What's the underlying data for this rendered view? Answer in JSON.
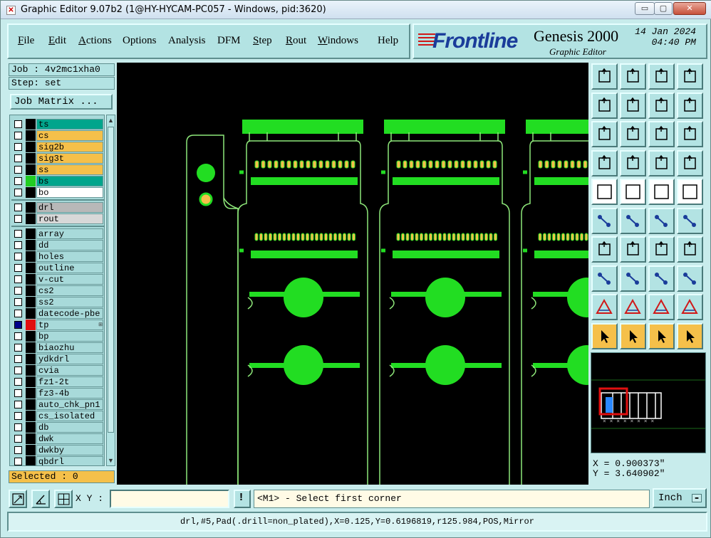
{
  "window": {
    "title": "Graphic Editor 9.07b2 (1@HY-HYCAM-PC057 - Windows, pid:3620)",
    "controls": {
      "minimize": "▭",
      "maximize": "▢",
      "close": "✕"
    }
  },
  "menu": [
    {
      "label": "File",
      "key": "file"
    },
    {
      "label": "Edit",
      "key": "edit"
    },
    {
      "label": "Actions",
      "key": "actions"
    },
    {
      "label": "Options",
      "key": "options"
    },
    {
      "label": "Analysis",
      "key": "analysis"
    },
    {
      "label": "DFM",
      "key": "dfm"
    },
    {
      "label": "Step",
      "key": "step"
    },
    {
      "label": "Rout",
      "key": "rout"
    },
    {
      "label": "Windows",
      "key": "windows"
    },
    {
      "label": "Help",
      "key": "help"
    }
  ],
  "brand": {
    "logo": "Frontline",
    "product": "Genesis 2000",
    "subtitle": "Graphic Editor",
    "date": "14 Jan 2024",
    "time": "04:40 PM"
  },
  "job": {
    "job_line": "Job : 4v2mc1xha0",
    "step_line": "Step: set",
    "matrix_button": "Job Matrix ..."
  },
  "layers": [
    {
      "name": "ts",
      "bg": "#00a58c",
      "swatch": "#000000",
      "checked": false
    },
    {
      "name": "cs",
      "bg": "#f5c04a",
      "swatch": "#000000",
      "checked": false
    },
    {
      "name": "sig2b",
      "bg": "#f5c04a",
      "swatch": "#000000",
      "checked": false
    },
    {
      "name": "sig3t",
      "bg": "#f5c04a",
      "swatch": "#000000",
      "checked": false
    },
    {
      "name": "ss",
      "bg": "#f5c04a",
      "swatch": "#000000",
      "checked": false
    },
    {
      "name": "bs",
      "bg": "#00a58c",
      "swatch": "#22cc22",
      "checked": false
    },
    {
      "name": "bo",
      "bg": "#ffffff",
      "swatch": "#000000",
      "checked": false
    },
    {
      "name": "drl",
      "bg": "#b8b8b8",
      "swatch": "#000000",
      "checked": false
    },
    {
      "name": "rout",
      "bg": "#d8d8d8",
      "swatch": "#000000",
      "checked": false
    },
    {
      "name": "array",
      "bg": "#a8dada",
      "swatch": "#000000",
      "checked": false
    },
    {
      "name": "dd",
      "bg": "#a8dada",
      "swatch": "#000000",
      "checked": false
    },
    {
      "name": "holes",
      "bg": "#a8dada",
      "swatch": "#000000",
      "checked": false
    },
    {
      "name": "outline",
      "bg": "#a8dada",
      "swatch": "#000000",
      "checked": false
    },
    {
      "name": "v-cut",
      "bg": "#a8dada",
      "swatch": "#000000",
      "checked": false
    },
    {
      "name": "cs2",
      "bg": "#a8dada",
      "swatch": "#000000",
      "checked": false
    },
    {
      "name": "ss2",
      "bg": "#a8dada",
      "swatch": "#000000",
      "checked": false
    },
    {
      "name": "datecode-pbe",
      "bg": "#a8dada",
      "swatch": "#000000",
      "checked": false
    },
    {
      "name": "tp",
      "bg": "#a8dada",
      "swatch": "#e01010",
      "checked": true,
      "marker": "⊞"
    },
    {
      "name": "bp",
      "bg": "#a8dada",
      "swatch": "#000000",
      "checked": false
    },
    {
      "name": "biaozhu",
      "bg": "#a8dada",
      "swatch": "#000000",
      "checked": false
    },
    {
      "name": "ydkdrl",
      "bg": "#a8dada",
      "swatch": "#000000",
      "checked": false
    },
    {
      "name": "cvia",
      "bg": "#a8dada",
      "swatch": "#000000",
      "checked": false
    },
    {
      "name": "fz1-2t",
      "bg": "#a8dada",
      "swatch": "#000000",
      "checked": false
    },
    {
      "name": "fz3-4b",
      "bg": "#a8dada",
      "swatch": "#000000",
      "checked": false
    },
    {
      "name": "auto_chk_pn1",
      "bg": "#a8dada",
      "swatch": "#000000",
      "checked": false
    },
    {
      "name": "cs_isolated",
      "bg": "#a8dada",
      "swatch": "#000000",
      "checked": false
    },
    {
      "name": "db",
      "bg": "#a8dada",
      "swatch": "#000000",
      "checked": false
    },
    {
      "name": "dwk",
      "bg": "#a8dada",
      "swatch": "#000000",
      "checked": false
    },
    {
      "name": "dwkby",
      "bg": "#a8dada",
      "swatch": "#000000",
      "checked": false
    },
    {
      "name": "qbdrl",
      "bg": "#a8dada",
      "swatch": "#000000",
      "checked": false
    }
  ],
  "selected_label": "Selected : 0",
  "tools": [
    "move-up-icon",
    "move-down-icon",
    "home-icon",
    "grid-view-icon",
    "import-icon",
    "export-icon",
    "undo-icon",
    "snake-icon",
    "fit-icon",
    "zoom-home-icon",
    "scale-1-2-icon",
    "help-icon",
    "settings-icon",
    "grid-icon",
    "layer-red-icon",
    "layer-red2-icon",
    "feature-icon",
    "shape-icon",
    "ruler-icon",
    "pad-icon",
    "connect-icon",
    "delete-icon",
    "line-point-icon",
    "line-blue-icon",
    "angle-icon",
    "slash-icon",
    "arc-icon",
    "split-icon",
    "pad-small-icon",
    "line-cross-icon",
    "measure-icon",
    "square-icon",
    "triangle-icon",
    "triangle-plus-icon",
    "triangle-a-icon",
    "triangle-cross-icon",
    "select-arrow-icon",
    "select-box-icon",
    "select-circle-icon",
    "select-net-icon"
  ],
  "coords": {
    "x": "X = 0.900373\"",
    "y": "Y = 3.640902\""
  },
  "input": {
    "xy_label": "X Y :",
    "xy_value": "",
    "info_button": "!"
  },
  "prompt": "<M1> - Select first corner",
  "units": "Inch",
  "status": "drl,#5,Pad(.drill=non_plated),X=0.125,Y=0.6196819,r125.984,POS,Mirror"
}
